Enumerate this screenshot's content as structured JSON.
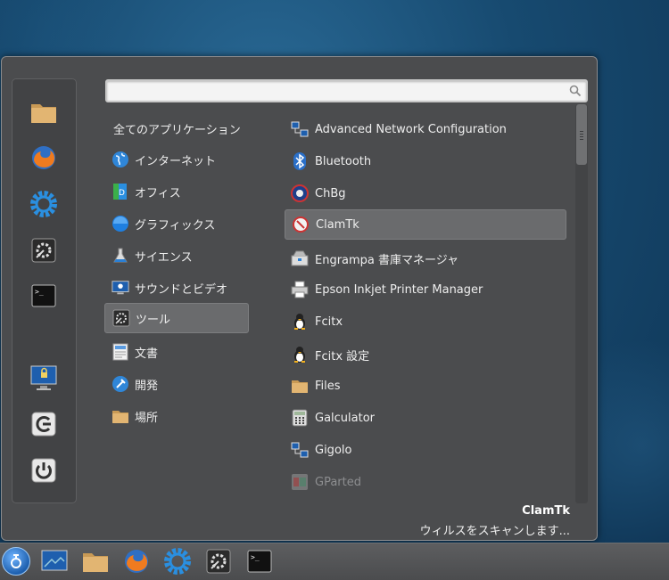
{
  "search": {
    "value": "",
    "placeholder": ""
  },
  "categories": [
    {
      "label": "全てのアプリケーション",
      "icon": "none"
    },
    {
      "label": "インターネット",
      "icon": "internet-icon"
    },
    {
      "label": "オフィス",
      "icon": "office-icon"
    },
    {
      "label": "グラフィックス",
      "icon": "graphics-icon"
    },
    {
      "label": "サイエンス",
      "icon": "science-icon"
    },
    {
      "label": "サウンドとビデオ",
      "icon": "sound-video-icon"
    },
    {
      "label": "ツール",
      "icon": "tools-icon",
      "selected": true
    },
    {
      "label": "文書",
      "icon": "document-icon"
    },
    {
      "label": "開発",
      "icon": "development-icon"
    },
    {
      "label": "場所",
      "icon": "folder-icon"
    }
  ],
  "apps": [
    {
      "label": "Advanced Network Configuration",
      "icon": "network-icon"
    },
    {
      "label": "Bluetooth",
      "icon": "bluetooth-icon"
    },
    {
      "label": "ChBg",
      "icon": "chbg-icon"
    },
    {
      "label": "ClamTk",
      "icon": "clamtk-icon",
      "selected": true
    },
    {
      "label": "Engrampa 書庫マネージャ",
      "icon": "archive-icon"
    },
    {
      "label": "Epson Inkjet Printer Manager",
      "icon": "printer-icon"
    },
    {
      "label": "Fcitx",
      "icon": "penguin-icon"
    },
    {
      "label": "Fcitx 設定",
      "icon": "penguin-icon"
    },
    {
      "label": "Files",
      "icon": "folder-icon"
    },
    {
      "label": "Galculator",
      "icon": "calculator-icon"
    },
    {
      "label": "Gigolo",
      "icon": "network-icon"
    },
    {
      "label": "GParted",
      "icon": "gparted-icon",
      "dim": true
    }
  ],
  "description": {
    "title": "ClamTk",
    "text": "ウィルスをスキャンします..."
  },
  "colors": {
    "menu_bg": "#4b4c4e",
    "selected": "#6a6b6d",
    "accent": "#2a7fd4"
  }
}
